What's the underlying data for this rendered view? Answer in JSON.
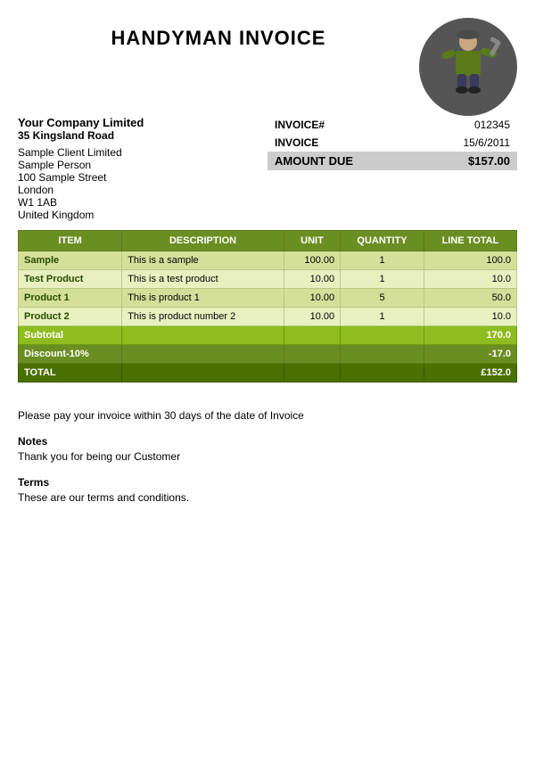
{
  "header": {
    "title": "HANDYMAN INVOICE"
  },
  "company": {
    "name": "Your Company Limited",
    "address_line1": "35 Kingsland Road",
    "address_line2": ""
  },
  "client": {
    "name": "Sample Client Limited",
    "contact": "Sample Person",
    "address1": "100 Sample Street",
    "city": "London",
    "postcode": "W1 1AB",
    "country": "United Kingdom"
  },
  "invoice": {
    "number_label": "INVOICE#",
    "number_value": "012345",
    "date_label": "INVOICE",
    "date_value": "15/6/2011",
    "amount_label": "AMOUNT DUE",
    "amount_value": "$157.00"
  },
  "table": {
    "headers": [
      "ITEM",
      "DESCRIPTION",
      "UNIT",
      "QUANTITY",
      "LINE TOTAL"
    ],
    "rows": [
      {
        "item": "Sample",
        "description": "This is a sample",
        "unit": "100.00",
        "quantity": "1",
        "line_total": "100.0"
      },
      {
        "item": "Test Product",
        "description": "This is a test product",
        "unit": "10.00",
        "quantity": "1",
        "line_total": "10.0"
      },
      {
        "item": "Product 1",
        "description": "This is product 1",
        "unit": "10.00",
        "quantity": "5",
        "line_total": "50.0"
      },
      {
        "item": "Product 2",
        "description": "This is product number 2",
        "unit": "10.00",
        "quantity": "1",
        "line_total": "10.0"
      }
    ],
    "subtotal_label": "Subtotal",
    "subtotal_value": "170.0",
    "discount_label": "Discount-10%",
    "discount_value": "-17.0",
    "total_label": "TOTAL",
    "total_value": "£152.0"
  },
  "payment_note": "Please pay your invoice within 30 days of the date of Invoice",
  "notes": {
    "title": "Notes",
    "text": "Thank you for being our Customer"
  },
  "terms": {
    "title": "Terms",
    "text": "These are our terms and conditions."
  }
}
